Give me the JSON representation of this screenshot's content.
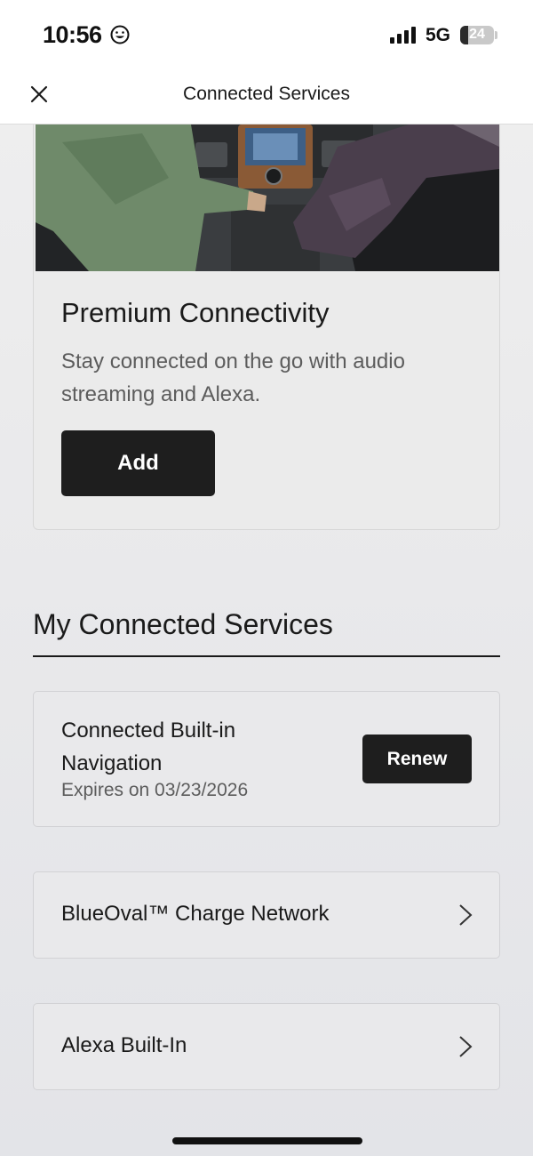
{
  "status_bar": {
    "time": "10:56",
    "network": "5G",
    "battery_level": "24",
    "battery_fraction": 0.24,
    "icons": [
      "smiley-icon",
      "signal-icon",
      "battery-icon"
    ]
  },
  "header": {
    "title": "Connected Services",
    "close_icon": "close-icon"
  },
  "promo": {
    "title": "Premium Connectivity",
    "description": "Stay connected on the go with audio streaming and Alexa.",
    "add_label": "Add"
  },
  "section": {
    "title": "My Connected Services"
  },
  "services": {
    "navigation": {
      "title": "Connected Built-in Navigation",
      "expiry": "Expires on 03/23/2026",
      "renew_label": "Renew"
    },
    "blueoval": {
      "label": "BlueOval™ Charge Network",
      "icon": "chevron-right-icon"
    },
    "alexa": {
      "label": "Alexa Built-In",
      "icon": "chevron-right-icon"
    }
  },
  "colors": {
    "primary_button": "#1e1e1e",
    "background": "#e9e9eb",
    "secondary_text": "#5c5c5c"
  }
}
